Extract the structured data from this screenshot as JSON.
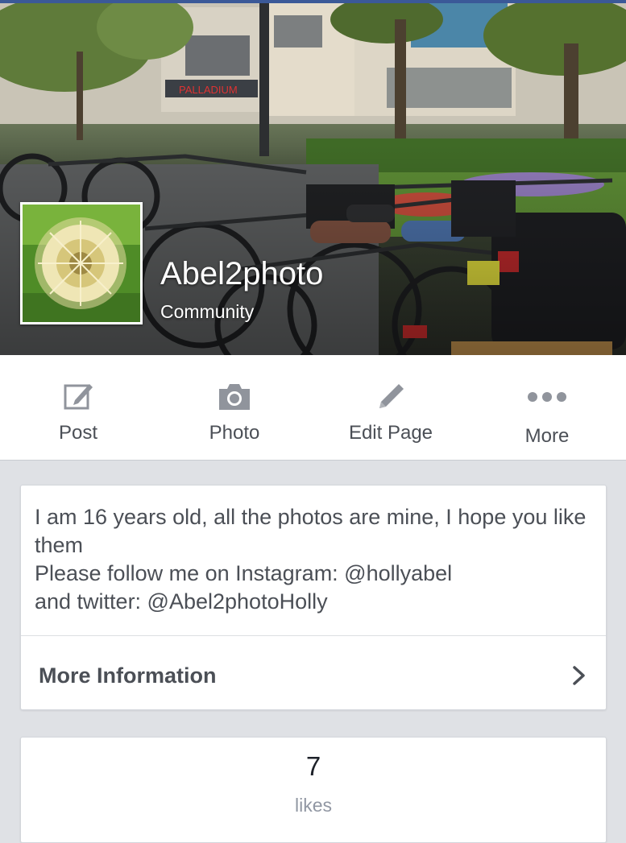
{
  "cover": {
    "page_name": "Abel2photo",
    "category": "Community",
    "image_description_icon": "bicycles-street-photo",
    "profile_image_icon": "dandelion-photo"
  },
  "actions": [
    {
      "label": "Post",
      "icon": "compose-icon"
    },
    {
      "label": "Photo",
      "icon": "camera-icon"
    },
    {
      "label": "Edit Page",
      "icon": "pencil-icon"
    },
    {
      "label": "More",
      "icon": "more-dots-icon"
    }
  ],
  "about": {
    "line1": "I am 16 years old, all the photos are mine, I hope you like them",
    "line2": "Please follow me on Instagram: @hollyabel",
    "line3": "and twitter: @Abel2photoHolly",
    "more_info_label": "More Information"
  },
  "likes": {
    "count": "7",
    "label": "likes"
  },
  "colors": {
    "brand": "#3b5998",
    "icon_gray": "#90949c",
    "text_dark": "#4b4f56",
    "background": "#dfe1e5"
  }
}
